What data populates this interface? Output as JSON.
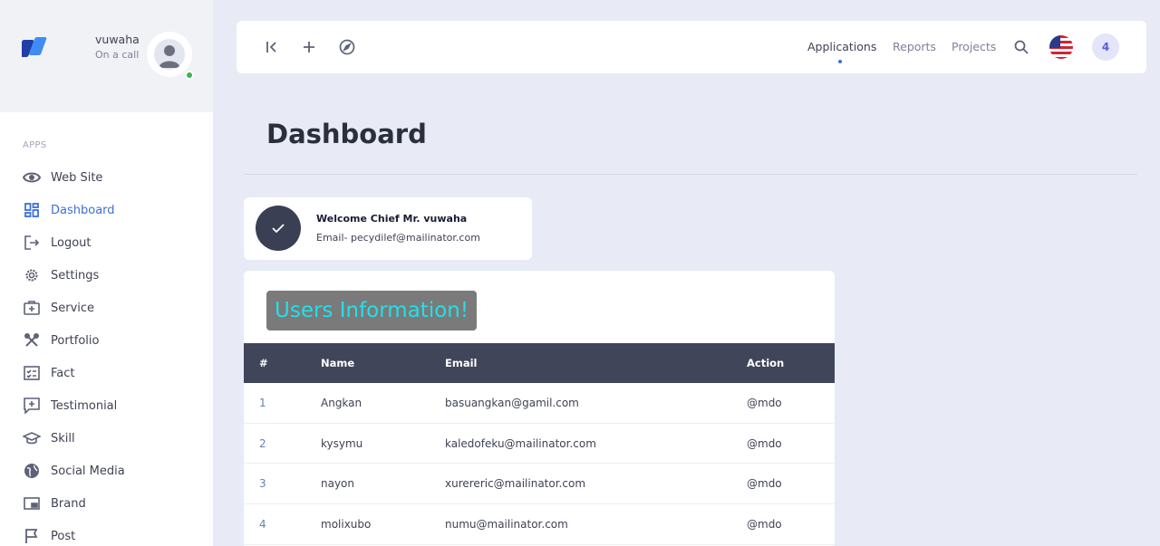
{
  "user": {
    "name": "vuwaha",
    "status": "On a call"
  },
  "sidebar": {
    "section_label": "APPS",
    "items": [
      {
        "label": "Web Site",
        "icon": "eye-icon"
      },
      {
        "label": "Dashboard",
        "icon": "dashboard-icon",
        "active": true
      },
      {
        "label": "Logout",
        "icon": "logout-icon"
      },
      {
        "label": "Settings",
        "icon": "gear-icon"
      },
      {
        "label": "Service",
        "icon": "medical-kit-icon"
      },
      {
        "label": "Portfolio",
        "icon": "tools-icon"
      },
      {
        "label": "Fact",
        "icon": "checklist-icon"
      },
      {
        "label": "Testimonial",
        "icon": "chat-plus-icon"
      },
      {
        "label": "Skill",
        "icon": "graduation-cap-icon"
      },
      {
        "label": "Social Media",
        "icon": "globe-icon"
      },
      {
        "label": "Brand",
        "icon": "monitor-icon"
      },
      {
        "label": "Post",
        "icon": "flag-icon"
      }
    ]
  },
  "topbar": {
    "links": [
      {
        "label": "Applications",
        "active": true
      },
      {
        "label": "Reports"
      },
      {
        "label": "Projects"
      }
    ],
    "notification_count": "4"
  },
  "page": {
    "title": "Dashboard"
  },
  "welcome": {
    "title": "Welcome Chief Mr. vuwaha",
    "email": "Email- pecydilef@mailinator.com"
  },
  "users": {
    "heading": "Users Information!",
    "columns": [
      "#",
      "Name",
      "Email",
      "Action"
    ],
    "rows": [
      {
        "num": "1",
        "name": "Angkan",
        "email": "basuangkan@gamil.com",
        "action": "@mdo"
      },
      {
        "num": "2",
        "name": "kysymu",
        "email": "kaledofeku@mailinator.com",
        "action": "@mdo"
      },
      {
        "num": "3",
        "name": "nayon",
        "email": "xurereric@mailinator.com",
        "action": "@mdo"
      },
      {
        "num": "4",
        "name": "molixubo",
        "email": "numu@mailinator.com",
        "action": "@mdo"
      }
    ]
  },
  "colors": {
    "accent": "#3e6fd8",
    "table_header": "#40455a",
    "heading_text": "#22e0e9",
    "online": "#3bb54a"
  }
}
